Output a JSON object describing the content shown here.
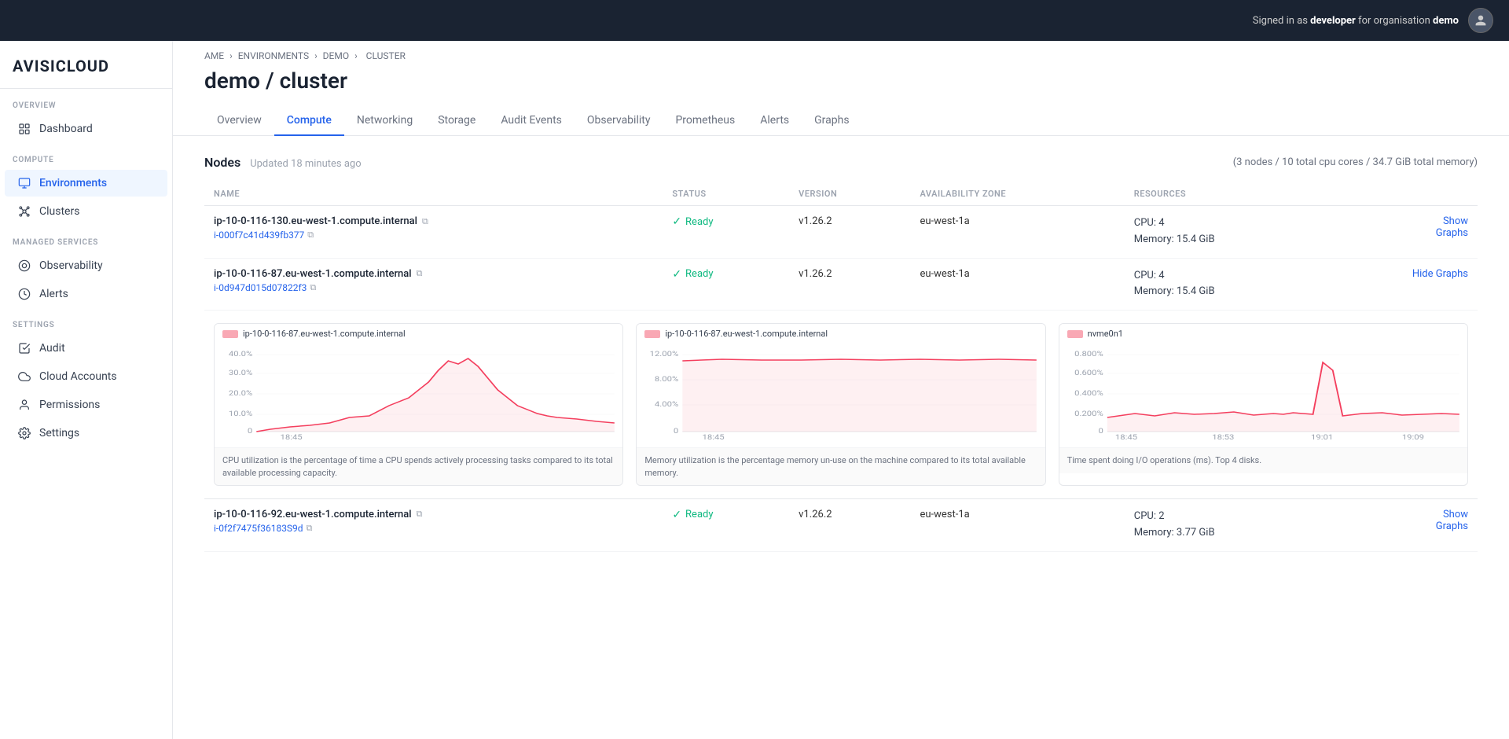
{
  "topbar": {
    "signed_in_text": "Signed in as",
    "user": "developer",
    "for_text": "for organisation",
    "org": "demo"
  },
  "logo": {
    "text": "AVISI",
    "text2": "CLOUD"
  },
  "sidebar": {
    "overview_label": "OVERVIEW",
    "compute_label": "COMPUTE",
    "managed_services_label": "MANAGED SERVICES",
    "settings_label": "SETTINGS",
    "items": [
      {
        "id": "dashboard",
        "label": "Dashboard",
        "icon": "dashboard",
        "active": false
      },
      {
        "id": "environments",
        "label": "Environments",
        "icon": "environments",
        "active": true
      },
      {
        "id": "clusters",
        "label": "Clusters",
        "icon": "clusters",
        "active": false
      },
      {
        "id": "observability",
        "label": "Observability",
        "icon": "observability",
        "active": false
      },
      {
        "id": "alerts",
        "label": "Alerts",
        "icon": "alerts",
        "active": false
      },
      {
        "id": "audit",
        "label": "Audit",
        "icon": "audit",
        "active": false
      },
      {
        "id": "cloud-accounts",
        "label": "Cloud Accounts",
        "icon": "cloud",
        "active": false
      },
      {
        "id": "permissions",
        "label": "Permissions",
        "icon": "permissions",
        "active": false
      },
      {
        "id": "settings",
        "label": "Settings",
        "icon": "settings",
        "active": false
      }
    ]
  },
  "breadcrumb": {
    "items": [
      "AME",
      "ENVIRONMENTS",
      "DEMO",
      "CLUSTER"
    ]
  },
  "page": {
    "title": "demo / cluster"
  },
  "tabs": [
    {
      "id": "overview",
      "label": "Overview",
      "active": false
    },
    {
      "id": "compute",
      "label": "Compute",
      "active": true
    },
    {
      "id": "networking",
      "label": "Networking",
      "active": false
    },
    {
      "id": "storage",
      "label": "Storage",
      "active": false
    },
    {
      "id": "audit-events",
      "label": "Audit Events",
      "active": false
    },
    {
      "id": "observability",
      "label": "Observability",
      "active": false
    },
    {
      "id": "prometheus",
      "label": "Prometheus",
      "active": false
    },
    {
      "id": "alerts",
      "label": "Alerts",
      "active": false
    },
    {
      "id": "graphs",
      "label": "Graphs",
      "active": false
    }
  ],
  "nodes": {
    "title": "Nodes",
    "updated": "Updated 18 minutes ago",
    "summary": "(3 nodes / 10 total cpu cores / 34.7 GiB total memory)",
    "columns": [
      "NAME",
      "STATUS",
      "VERSION",
      "AVAILABILITY ZONE",
      "RESOURCES"
    ],
    "rows": [
      {
        "name": "ip-10-0-116-130.eu-west-1.compute.internal",
        "id": "i-000f7c41d439fb377",
        "status": "Ready",
        "version": "v1.26.2",
        "az": "eu-west-1a",
        "cpu": "CPU: 4",
        "memory": "Memory: 15.4 GiB",
        "action": "Show Graphs",
        "expanded": false
      },
      {
        "name": "ip-10-0-116-87.eu-west-1.compute.internal",
        "id": "i-0d947d015d07822f3",
        "status": "Ready",
        "version": "v1.26.2",
        "az": "eu-west-1a",
        "cpu": "CPU: 4",
        "memory": "Memory: 15.4 GiB",
        "action": "Hide Graphs",
        "expanded": true
      },
      {
        "name": "ip-10-0-116-92.eu-west-1.compute.internal",
        "id": "i-0f2f7475f36183S9d",
        "status": "Ready",
        "version": "v1.26.2",
        "az": "eu-west-1a",
        "cpu": "CPU: 2",
        "memory": "Memory: 3.77 GiB",
        "action": "Show Graphs",
        "expanded": false
      }
    ],
    "graphs": {
      "cpu": {
        "legend": "ip-10-0-116-87.eu-west-1.compute.internal",
        "y_labels": [
          "40.0%",
          "30.0%",
          "20.0%",
          "10.0%",
          "0"
        ],
        "x_labels": [
          "18:45"
        ],
        "description": "CPU utilization is the percentage of time a CPU spends actively processing tasks compared to its total available processing capacity."
      },
      "memory": {
        "legend": "ip-10-0-116-87.eu-west-1.compute.internal",
        "y_labels": [
          "12.00%",
          "8.00%",
          "4.00%",
          "0"
        ],
        "x_labels": [
          "18:45"
        ],
        "description": "Memory utilization is the percentage memory un-use on the machine compared to its total available memory."
      },
      "io": {
        "legend": "nvme0n1",
        "y_labels": [
          "0.800%",
          "0.600%",
          "0.400%",
          "0.200%",
          "0"
        ],
        "x_labels": [
          "18:45",
          "18:53",
          "19:01",
          "19:09"
        ],
        "description": "Time spent doing I/O operations (ms). Top 4 disks."
      }
    }
  }
}
